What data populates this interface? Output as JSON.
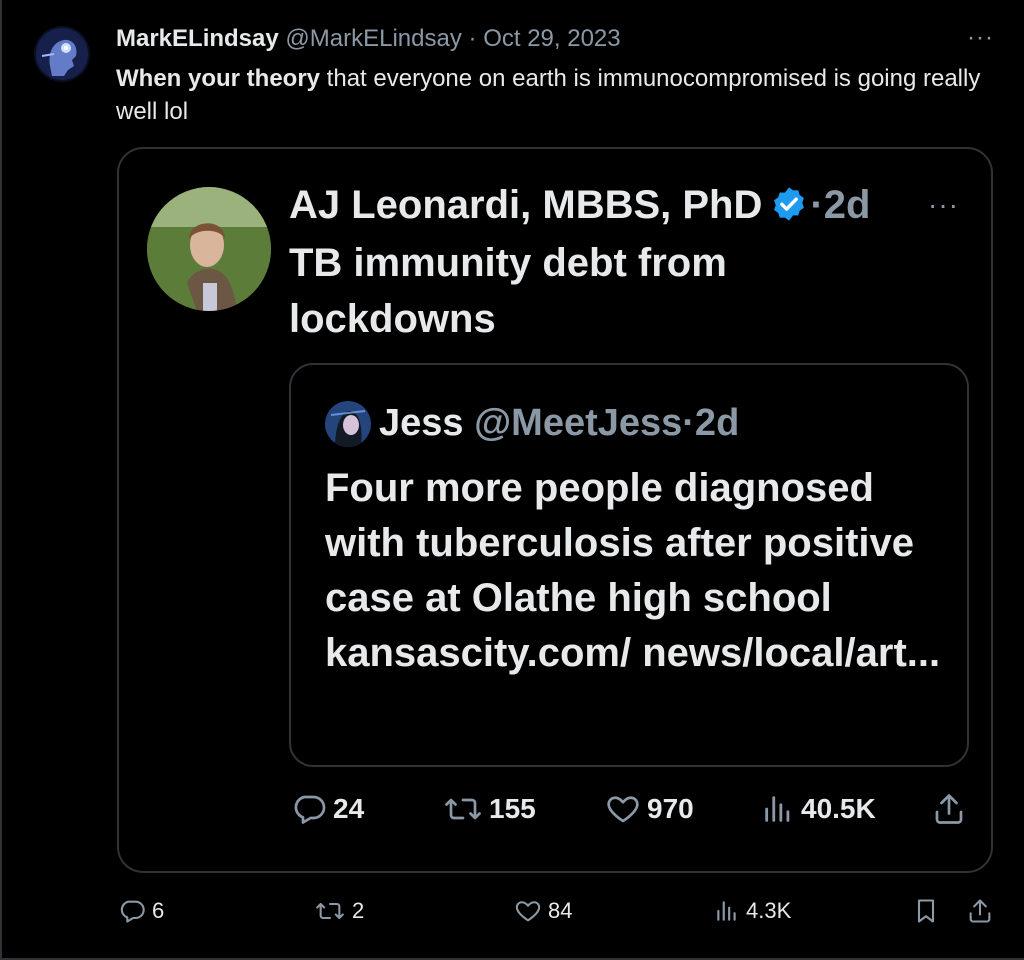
{
  "outer_tweet": {
    "name": "MarkELindsay",
    "handle": "@MarkELindsay",
    "separator": "·",
    "date": "Oct 29, 2023",
    "more": "···",
    "text_bold": "When your theory",
    "text_rest": " that everyone on earth is immunocompromised is going really well lol",
    "actions": {
      "replies": "6",
      "retweets": "2",
      "likes": "84",
      "views": "4.3K"
    }
  },
  "quoted_tweet": {
    "name": "AJ Leonardi, MBBS, PhD",
    "time": "·2d",
    "more": "···",
    "text": "TB immunity debt from lockdowns",
    "actions": {
      "replies": "24",
      "retweets": "155",
      "likes": "970",
      "views": "40.5K"
    }
  },
  "nested_quote": {
    "name": "Jess",
    "handle": "@MeetJess",
    "time": "·2d",
    "text": "Four more people diagnosed with tuberculosis after positive case at Olathe high school kansascity.com/ news/local/art..."
  },
  "colors": {
    "background": "#000000",
    "text": "#e7e9ea",
    "muted": "#8b98a5",
    "border": "#2f3336",
    "verified": "#1d9bf0"
  },
  "icons": [
    "more-icon",
    "verified-badge-icon",
    "reply-icon",
    "retweet-icon",
    "like-icon",
    "views-icon",
    "share-icon",
    "bookmark-icon"
  ]
}
